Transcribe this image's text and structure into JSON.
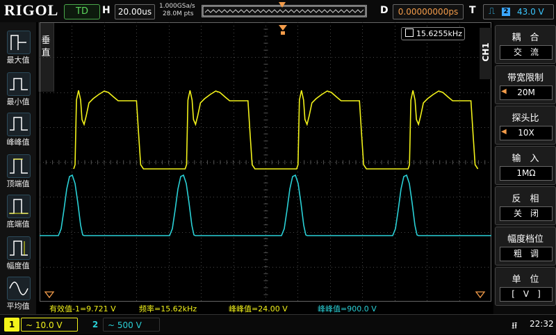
{
  "topbar": {
    "logo": "RIGOL",
    "run_status": "TD",
    "h_label": "H",
    "timebase": "20.00us",
    "sample_rate": "1.000GSa/s",
    "memory_depth": "28.0M pts",
    "d_label": "D",
    "delay": "0.00000000ps",
    "t_label": "T",
    "trigger_edge_icon": "rising-edge-icon",
    "trigger_source": "2",
    "trigger_level": "43.0 V"
  },
  "left_panel": {
    "items": [
      {
        "label": "最大值",
        "icon": "max-value-icon"
      },
      {
        "label": "最小值",
        "icon": "min-value-icon"
      },
      {
        "label": "峰峰值",
        "icon": "peak-peak-icon"
      },
      {
        "label": "顶端值",
        "icon": "top-value-icon"
      },
      {
        "label": "底端值",
        "icon": "base-value-icon"
      },
      {
        "label": "幅度值",
        "icon": "amplitude-icon"
      },
      {
        "label": "平均值",
        "icon": "average-icon"
      }
    ],
    "side_tab": [
      "垂",
      "直"
    ]
  },
  "screen": {
    "frequency_counter": "15.6255kHz",
    "colors": {
      "ch1": "#f3f31a",
      "ch2": "#2ad1d7",
      "grid": "#5a5a5a",
      "marker": "#f39c4a"
    }
  },
  "measurements": {
    "m1": "有效值-1=9.721 V",
    "m2": "频率=15.62kHz",
    "m3": "峰峰值=24.00 V",
    "m4": "峰峰值=900.0 V"
  },
  "right_menu": {
    "channel_tag": "CH1",
    "items": [
      {
        "title": "耦　合",
        "value": "交　流"
      },
      {
        "title": "带宽限制",
        "value": "20M"
      },
      {
        "title": "探头比",
        "value": "10X"
      },
      {
        "title": "输　入",
        "value": "1MΩ"
      },
      {
        "title": "反　相",
        "value": "关　闭"
      },
      {
        "title": "幅度档位",
        "value": "粗　调"
      },
      {
        "title": "单　位",
        "value": "[　V　]"
      }
    ]
  },
  "bottom": {
    "ch1_num": "1",
    "ch1_setting": "~ 10.0 V",
    "ch2_num": "2",
    "ch2_setting": "~ 500 V",
    "usb_icon": "usb-icon",
    "clock": "22:32"
  }
}
